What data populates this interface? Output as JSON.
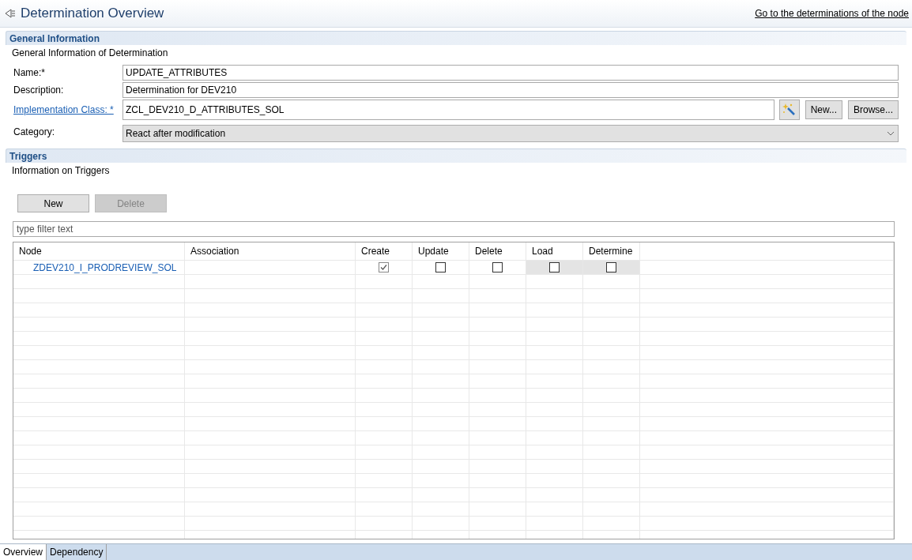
{
  "header": {
    "title": "Determination Overview",
    "link": "Go to the determinations of the node"
  },
  "general": {
    "title": "General Information",
    "subtitle": "General Information of Determination",
    "fields": [
      {
        "kind": "text",
        "label": "Name:*",
        "value": "UPDATE_ATTRIBUTES"
      },
      {
        "kind": "text",
        "label": "Description:",
        "value": "Determination for DEV210"
      },
      {
        "kind": "class",
        "label": "Implementation Class: *",
        "value": "ZCL_DEV210_D_ATTRIBUTES_SOL",
        "buttons": [
          "New...",
          "Browse..."
        ]
      },
      {
        "kind": "select",
        "label": "Category:",
        "value": "React after modification"
      }
    ]
  },
  "triggers": {
    "title": "Triggers",
    "subtitle": "Information on Triggers",
    "buttons": [
      {
        "label": "New",
        "disabled": false
      },
      {
        "label": "Delete",
        "disabled": true
      }
    ],
    "filter": {
      "placeholder": "type filter text"
    },
    "table": {
      "columns": [
        "Node",
        "Association",
        "Create",
        "Update",
        "Delete",
        "Load",
        "Determine"
      ],
      "rows": [
        {
          "node": "ZDEV210_I_PRODREVIEW_SOL",
          "association": "",
          "checks": [
            {
              "checked": true,
              "disabled": false
            },
            {
              "checked": false,
              "disabled": false
            },
            {
              "checked": false,
              "disabled": false
            },
            {
              "checked": false,
              "disabled": true
            },
            {
              "checked": false,
              "disabled": true
            }
          ]
        }
      ]
    }
  },
  "bottom_tabs": [
    {
      "label": "Overview",
      "selected": true
    },
    {
      "label": "Dependency",
      "selected": false
    }
  ]
}
